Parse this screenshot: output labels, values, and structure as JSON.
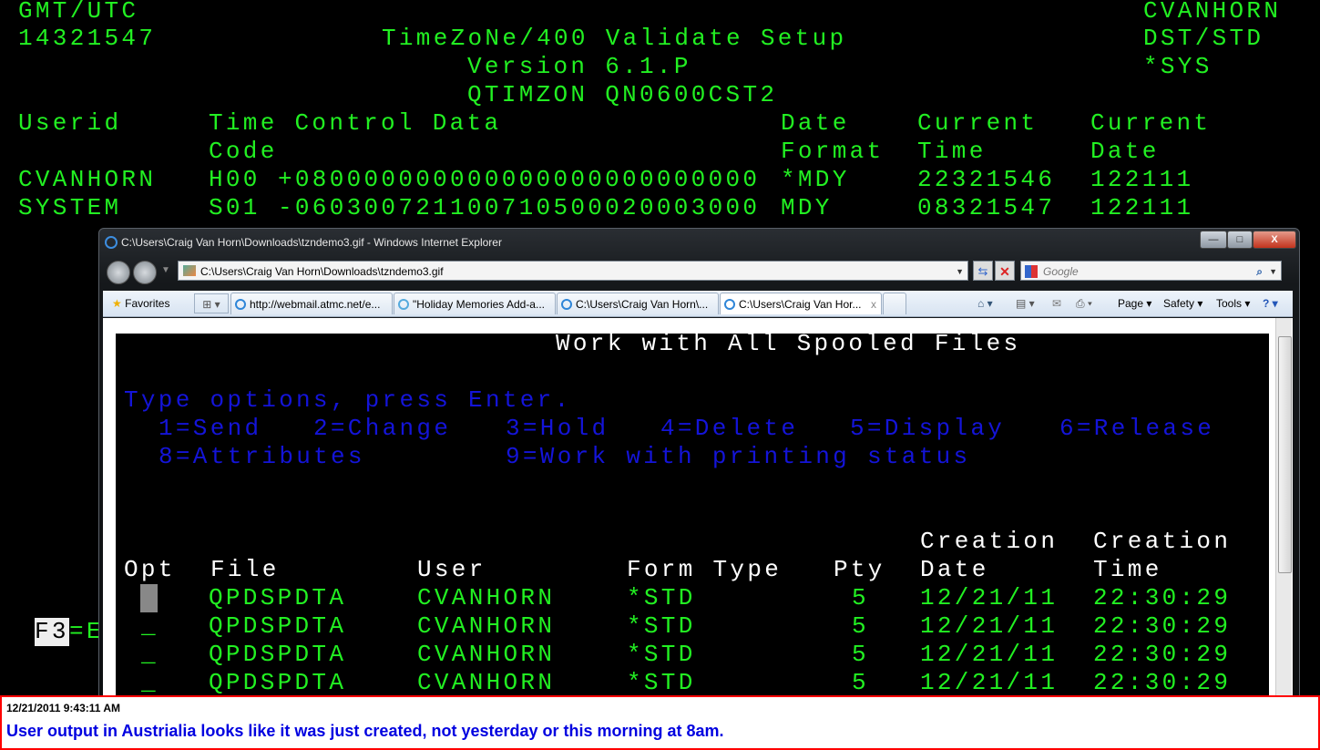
{
  "terminal": {
    "gmt_label": "GMT/UTC",
    "gmt_time": "14321547",
    "title": "TimeZoNe/400 Validate Setup",
    "version": "Version 6.1.P",
    "program": "QTIMZON QN0600CST2",
    "user": "CVANHORN",
    "dst_label": "DST/STD",
    "sys": "*SYS",
    "headers": {
      "userid": "Userid",
      "tcd": "Time Control Data",
      "code": "Code",
      "date1": "Date",
      "date2": "Format",
      "ctime1": "Current",
      "ctime2": "Time",
      "cdate1": "Current",
      "cdate2": "Date"
    },
    "rows": [
      {
        "userid": "CVANHORN",
        "code": "H00",
        "data": "+080000000000000000000000000",
        "format": "*MDY",
        "time": "22321546",
        "date": "122111"
      },
      {
        "userid": "SYSTEM",
        "code": "S01",
        "data": "-060300721100710500020003000",
        "format": "MDY",
        "time": "08321547",
        "date": "122111"
      }
    ],
    "fkey": "F3",
    "fkey_rest": "=E"
  },
  "browser": {
    "window_title": "C:\\Users\\Craig Van Horn\\Downloads\\tzndemo3.gif - Windows Internet Explorer",
    "address": "C:\\Users\\Craig Van Horn\\Downloads\\tzndemo3.gif",
    "search_placeholder": "Google",
    "favorites": "Favorites",
    "tabs": [
      {
        "label": "http://webmail.atmc.net/e...",
        "active": false
      },
      {
        "label": "\"Holiday Memories Add-a...",
        "active": false
      },
      {
        "label": "C:\\Users\\Craig Van Horn\\...",
        "active": false
      },
      {
        "label": "C:\\Users\\Craig Van Hor...",
        "active": true
      }
    ],
    "commands": {
      "page": "Page ▾",
      "safety": "Safety ▾",
      "tools": "Tools ▾"
    },
    "window_buttons": {
      "minimize": "—",
      "maximize": "□",
      "close": "X"
    }
  },
  "spool": {
    "title": "Work with All Spooled Files",
    "instructions": "Type options, press Enter.",
    "options_line1": [
      "1=Send",
      "2=Change",
      "3=Hold",
      "4=Delete",
      "5=Display",
      "6=Release"
    ],
    "options_line2": [
      "8=Attributes",
      "9=Work with printing status"
    ],
    "columns": {
      "opt": "Opt",
      "file": "File",
      "user": "User",
      "form": "Form Type",
      "pty": "Pty",
      "cdate1": "Creation",
      "cdate2": "Date",
      "ctime1": "Creation",
      "ctime2": "Time"
    },
    "rows": [
      {
        "opt": "",
        "file": "QPDSPDTA",
        "user": "CVANHORN",
        "form": "*STD",
        "pty": "5",
        "date": "12/21/11",
        "time": "22:30:29"
      },
      {
        "opt": "_",
        "file": "QPDSPDTA",
        "user": "CVANHORN",
        "form": "*STD",
        "pty": "5",
        "date": "12/21/11",
        "time": "22:30:29"
      },
      {
        "opt": "_",
        "file": "QPDSPDTA",
        "user": "CVANHORN",
        "form": "*STD",
        "pty": "5",
        "date": "12/21/11",
        "time": "22:30:29"
      },
      {
        "opt": "_",
        "file": "QPDSPDTA",
        "user": "CVANHORN",
        "form": "*STD",
        "pty": "5",
        "date": "12/21/11",
        "time": "22:30:29"
      }
    ]
  },
  "note": {
    "timestamp": "12/21/2011 9:43:11 AM",
    "message": "User output in Austrialia looks like it was just created, not yesterday or this morning at 8am."
  },
  "colors": {
    "terminal_green": "#22f022",
    "terminal_blue": "#1414d8",
    "note_border": "#ff0000",
    "note_text": "#0000e0"
  }
}
